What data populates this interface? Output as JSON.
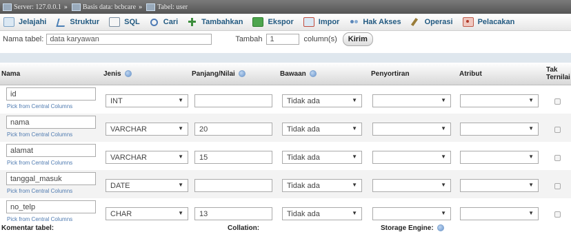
{
  "breadcrumb": {
    "server": "Server: 127.0.0.1",
    "database": "Basis data: bcbcare",
    "table": "Tabel: user"
  },
  "tabs": [
    {
      "label": "Jelajahi",
      "icon": "browse-icon"
    },
    {
      "label": "Struktur",
      "icon": "structure-icon"
    },
    {
      "label": "SQL",
      "icon": "sql-icon"
    },
    {
      "label": "Cari",
      "icon": "search-icon"
    },
    {
      "label": "Tambahkan",
      "icon": "insert-icon"
    },
    {
      "label": "Ekspor",
      "icon": "export-icon"
    },
    {
      "label": "Impor",
      "icon": "import-icon"
    },
    {
      "label": "Hak Akses",
      "icon": "privileges-icon"
    },
    {
      "label": "Operasi",
      "icon": "operations-icon"
    },
    {
      "label": "Pelacakan",
      "icon": "tracking-icon"
    }
  ],
  "form": {
    "table_name_label": "Nama tabel:",
    "table_name_value": "data karyawan",
    "add_label": "Tambah",
    "add_count": "1",
    "columns_label": "column(s)",
    "submit_label": "Kirim"
  },
  "headers": {
    "name": "Nama",
    "type": "Jenis",
    "length": "Panjang/Nilai",
    "default": "Bawaan",
    "collation": "Penyortiran",
    "attribute": "Atribut",
    "null_line1": "Tak",
    "null_line2": "Ternilai"
  },
  "pick_label": "Pick from Central Columns",
  "rows": [
    {
      "name": "id",
      "type": "INT",
      "length": "",
      "default": "Tidak ada",
      "collation": "",
      "attribute": ""
    },
    {
      "name": "nama",
      "type": "VARCHAR",
      "length": "20",
      "default": "Tidak ada",
      "collation": "",
      "attribute": ""
    },
    {
      "name": "alamat",
      "type": "VARCHAR",
      "length": "15",
      "default": "Tidak ada",
      "collation": "",
      "attribute": ""
    },
    {
      "name": "tanggal_masuk",
      "type": "DATE",
      "length": "",
      "default": "Tidak ada",
      "collation": "",
      "attribute": ""
    },
    {
      "name": "no_telp",
      "type": "CHAR",
      "length": "13",
      "default": "Tidak ada",
      "collation": "",
      "attribute": ""
    }
  ],
  "footer": {
    "comment_label": "Komentar tabel:",
    "collation_label": "Collation:",
    "engine_label": "Storage Engine:"
  },
  "colors": {
    "tab_text": "#235a81",
    "link": "#4e7ab0",
    "band": "#dfe7ee"
  }
}
